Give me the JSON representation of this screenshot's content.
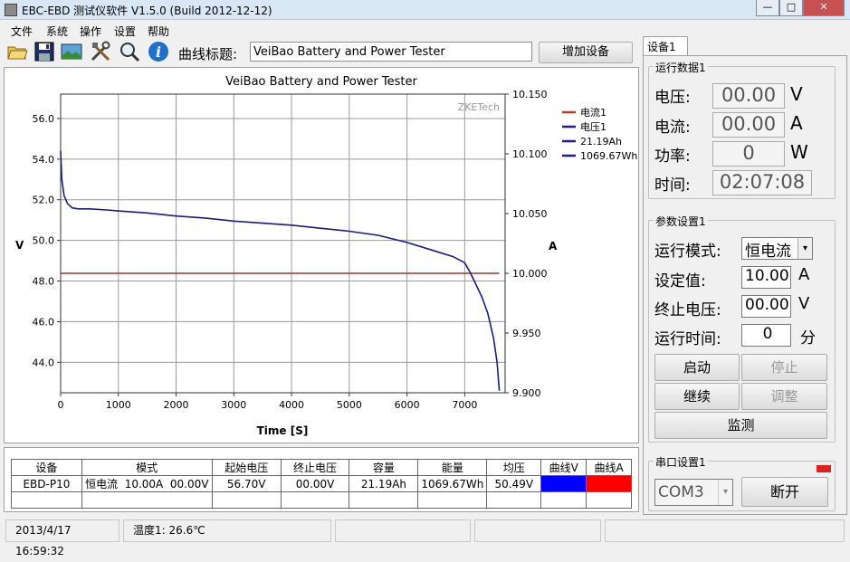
{
  "window": {
    "title": "EBC-EBD 测试仪软件 V1.5.0 (Build 2012-12-12)",
    "min": "—",
    "max": "□",
    "close": "✕"
  },
  "menu": [
    "文件",
    "系统",
    "操作",
    "设置",
    "帮助"
  ],
  "toolbar": {
    "icons": [
      "folder-icon",
      "save-icon",
      "image-icon",
      "tools-icon",
      "search-icon",
      "info-icon"
    ],
    "curve_title_label": "曲线标题:",
    "curve_title_value": "VeiBao Battery and Power Tester",
    "add_device": "增加设备"
  },
  "chart_data": {
    "type": "line",
    "title": "VeiBao Battery and Power Tester",
    "watermark": "ZKETech",
    "xlabel": "Time [S]",
    "ylabel_left": "V",
    "ylabel_right": "A",
    "xlim": [
      0,
      7700
    ],
    "ylim_left": [
      42.5,
      57.2
    ],
    "ylim_right": [
      9.9,
      10.15
    ],
    "x_ticks": [
      "0",
      "1000",
      "2000",
      "3000",
      "4000",
      "5000",
      "6000",
      "7000"
    ],
    "y_ticks_left": [
      "56.0",
      "54.0",
      "52.0",
      "50.0",
      "48.0",
      "46.0",
      "44.0"
    ],
    "y_ticks_right": [
      "10.150",
      "10.100",
      "10.050",
      "10.000",
      "9.950",
      "9.900"
    ],
    "legend": [
      "电流1",
      "电压1",
      "21.19Ah",
      "1069.67Wh"
    ],
    "legend_colors": [
      "#c0392b",
      "#1a1aa0",
      "#1a1aa0",
      "#1a1aa0"
    ],
    "series": [
      {
        "name": "电流1",
        "axis": "right",
        "color": "#a93226",
        "x": [
          0,
          7600
        ],
        "y": [
          10.0,
          10.0
        ]
      },
      {
        "name": "电压1",
        "axis": "left",
        "color": "#1a1a8c",
        "x": [
          0,
          20,
          60,
          120,
          200,
          300,
          500,
          800,
          1000,
          1500,
          2000,
          2500,
          3000,
          3500,
          4000,
          4500,
          5000,
          5500,
          6000,
          6400,
          6800,
          7000,
          7100,
          7200,
          7300,
          7400,
          7500,
          7560,
          7600
        ],
        "y": [
          54.4,
          53.0,
          52.2,
          51.8,
          51.6,
          51.55,
          51.55,
          51.5,
          51.45,
          51.35,
          51.2,
          51.1,
          50.95,
          50.85,
          50.75,
          50.6,
          50.45,
          50.25,
          49.9,
          49.55,
          49.2,
          48.9,
          48.4,
          47.8,
          47.2,
          46.4,
          45.2,
          44.0,
          42.6
        ]
      }
    ]
  },
  "table": {
    "headers": [
      "设备",
      "模式",
      "起始电压",
      "终止电压",
      "容量",
      "能量",
      "均压",
      "曲线V",
      "曲线A"
    ],
    "row": [
      "EBD-P10",
      "恒电流  10.00A  00.00V",
      "56.70V",
      "00.00V",
      "21.19Ah",
      "1069.67Wh",
      "50.49V",
      "",
      ""
    ],
    "curve_v_color": "#0000ff",
    "curve_a_color": "#ff0000"
  },
  "status": {
    "datetime": "2013/4/17 16:59:32",
    "temp": "温度1: 26.6℃"
  },
  "device_tab": "设备1",
  "run_data": {
    "title": "运行数据1",
    "voltage_label": "电压:",
    "voltage": "00.00",
    "voltage_unit": "V",
    "current_label": "电流:",
    "current": "00.00",
    "current_unit": "A",
    "power_label": "功率:",
    "power": "0",
    "power_unit": "W",
    "time_label": "时间:",
    "time": "02:07:08"
  },
  "params": {
    "title": "参数设置1",
    "mode_label": "运行模式:",
    "mode": "恒电流",
    "set_label": "设定值:",
    "set": "10.00",
    "set_unit": "A",
    "cutoff_label": "终止电压:",
    "cutoff": "00.00",
    "cutoff_unit": "V",
    "runtime_label": "运行时间:",
    "runtime": "0",
    "runtime_unit": "分",
    "start": "启动",
    "stop": "停止",
    "continue": "继续",
    "adjust": "调整",
    "monitor": "监测"
  },
  "serial": {
    "title": "串口设置1",
    "port": "COM3",
    "disconnect": "断开",
    "indicator_color": "#e02020"
  }
}
